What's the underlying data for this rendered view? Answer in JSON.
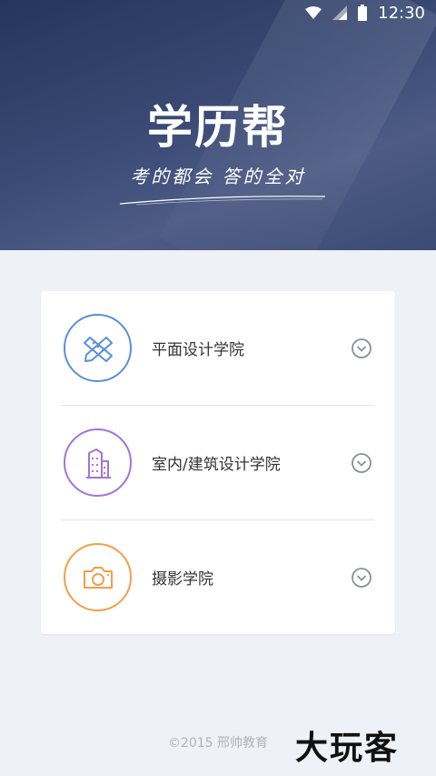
{
  "status_bar": {
    "time": "12:30"
  },
  "hero": {
    "title": "学历帮",
    "slogan": "考的都会 答的全对"
  },
  "colleges": [
    {
      "label": "平面设计学院",
      "icon": "pen-ruler-icon",
      "color": "#5b8fd9"
    },
    {
      "label": "室内/建筑设计学院",
      "icon": "building-icon",
      "color": "#a374d6"
    },
    {
      "label": "摄影学院",
      "icon": "camera-icon",
      "color": "#f0a04b"
    }
  ],
  "footer": {
    "copyright": "©2015 邢帅教育"
  },
  "watermark": "大玩客"
}
